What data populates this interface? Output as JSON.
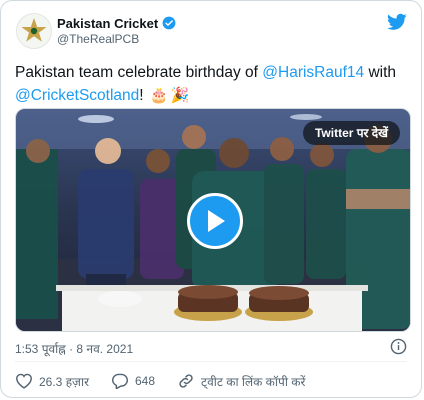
{
  "account": {
    "display_name": "Pakistan Cricket",
    "handle": "@TheRealPCB",
    "avatar_icon": "star-crest-logo",
    "verified_icon": "verified-badge-icon"
  },
  "tweet": {
    "text_part1": "Pakistan team celebrate birthday of ",
    "mention1": "@HarisRauf14",
    "text_part2": " with ",
    "mention2": "@CricketScotland",
    "text_part3": "!",
    "emoji1": "🎂",
    "emoji2": "🎉"
  },
  "media": {
    "watch_on_twitter": "Twitter पर देखें",
    "play_icon": "play-icon"
  },
  "meta": {
    "timestamp": "1:53 पूर्वाह्न · 8 नव. 2021"
  },
  "actions": {
    "likes": "26.3 हज़ार",
    "replies": "648",
    "copy_link": "ट्वीट का लिंक कॉपी करें"
  },
  "colors": {
    "link": "#1d9bf0",
    "secondary_text": "#536471",
    "like_icon": "#536471"
  }
}
